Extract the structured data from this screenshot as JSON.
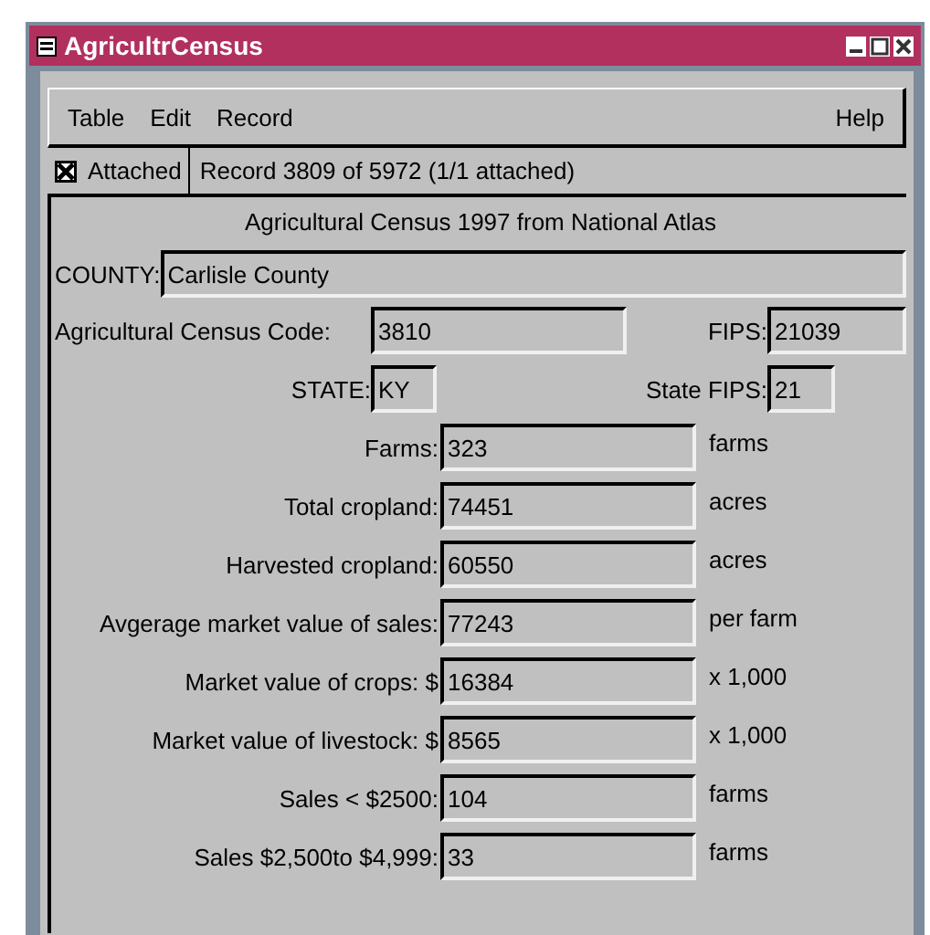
{
  "window": {
    "title": "AgricultrCensus"
  },
  "menu": {
    "items": [
      "Table",
      "Edit",
      "Record"
    ],
    "help": "Help"
  },
  "attached": {
    "label": "Attached",
    "checked": true
  },
  "record_status": "Record 3809 of 5972 (1/1 attached)",
  "panel_title": "Agricultural Census 1997 from National Atlas",
  "county": {
    "label": "COUNTY:",
    "value": "Carlisle County"
  },
  "code_row": [
    {
      "label": "Agricultural Census Code:",
      "value": "3810"
    },
    {
      "label": "FIPS:",
      "value": "21039"
    }
  ],
  "state_row": [
    {
      "label": "STATE:",
      "value": "KY"
    },
    {
      "label": "State FIPS:",
      "value": "21"
    }
  ],
  "measures": [
    {
      "label": "Farms:",
      "value": "323",
      "unit": "farms"
    },
    {
      "label": "Total cropland:",
      "value": "74451",
      "unit": "acres"
    },
    {
      "label": "Harvested cropland:",
      "value": "60550",
      "unit": "acres"
    },
    {
      "label": "Avgerage market value of sales:",
      "value": "77243",
      "unit": "per farm"
    },
    {
      "label": "Market value of crops: $",
      "value": "16384",
      "unit": "x 1,000"
    },
    {
      "label": "Market value of livestock: $",
      "value": "8565",
      "unit": "x 1,000"
    },
    {
      "label": "Sales < $2500:",
      "value": "104",
      "unit": "farms"
    },
    {
      "label": "Sales $2,500to $4,999:",
      "value": "33",
      "unit": "farms"
    }
  ]
}
